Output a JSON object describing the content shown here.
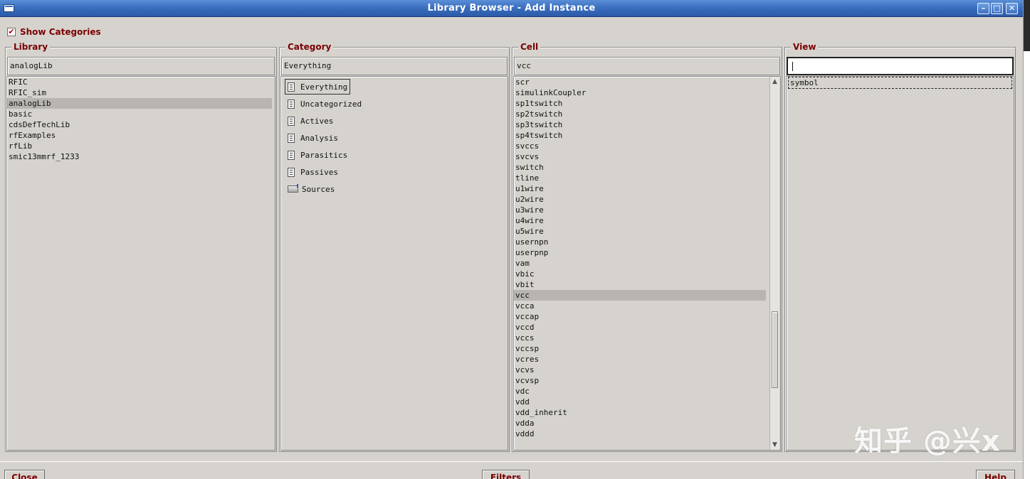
{
  "window": {
    "title": "Library Browser - Add Instance",
    "buttons": [
      "–",
      "□",
      "✕"
    ]
  },
  "show_categories": {
    "label": "Show Categories",
    "checked": true,
    "mark": "✔"
  },
  "library": {
    "title": "Library",
    "filter_value": "analogLib",
    "items": [
      "RFIC",
      "RFIC_sim",
      "analogLib",
      "basic",
      "cdsDefTechLib",
      "rfExamples",
      "rfLib",
      "smic13mmrf_1233"
    ],
    "selected": "analogLib"
  },
  "category": {
    "title": "Category",
    "filter_value": "Everything",
    "items": [
      {
        "label": "Everything",
        "icon": "category-icon"
      },
      {
        "label": "Uncategorized",
        "icon": "category-icon"
      },
      {
        "label": "Actives",
        "icon": "category-icon"
      },
      {
        "label": "Analysis",
        "icon": "category-icon"
      },
      {
        "label": "Parasitics",
        "icon": "category-icon"
      },
      {
        "label": "Passives",
        "icon": "category-icon"
      },
      {
        "label": "Sources",
        "icon": "folder-icon"
      }
    ],
    "selected": "Everything"
  },
  "cell": {
    "title": "Cell",
    "filter_value": "vcc",
    "items": [
      "scr",
      "simulinkCoupler",
      "sp1tswitch",
      "sp2tswitch",
      "sp3tswitch",
      "sp4tswitch",
      "svccs",
      "svcvs",
      "switch",
      "tline",
      "u1wire",
      "u2wire",
      "u3wire",
      "u4wire",
      "u5wire",
      "usernpn",
      "userpnp",
      "vam",
      "vbic",
      "vbit",
      "vcc",
      "vcca",
      "vccap",
      "vccd",
      "vccs",
      "vccsp",
      "vcres",
      "vcvs",
      "vcvsp",
      "vdc",
      "vdd",
      "vdd_inherit",
      "vdda",
      "vddd"
    ],
    "selected": "vcc"
  },
  "view": {
    "title": "View",
    "filter_value": "",
    "items": [
      "symbol"
    ]
  },
  "bottom_buttons": {
    "close": "Close",
    "filters": "Filters",
    "help": "Help"
  },
  "watermark": "知乎 @兴x",
  "colors": {
    "titlebar": "#3b6fc0",
    "label_red": "#7a0000",
    "bg": "#d6d3ce",
    "selection": "#b8b5b0"
  }
}
